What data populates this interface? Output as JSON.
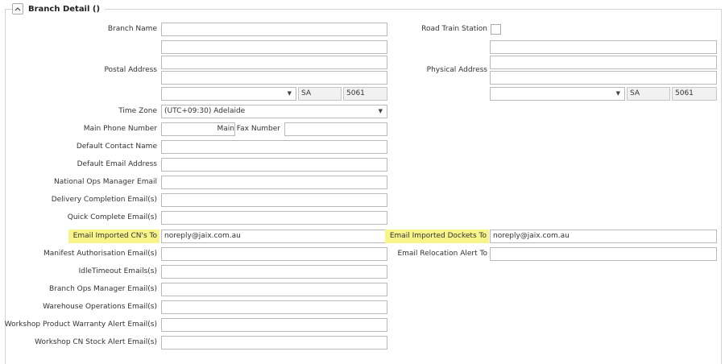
{
  "group": {
    "title": "Branch Detail ()"
  },
  "labels": {
    "branch_name": "Branch Name",
    "postal_address": "Postal Address",
    "time_zone": "Time Zone",
    "main_phone": "Main Phone Number",
    "main_fax": "Main Fax Number",
    "default_contact": "Default Contact Name",
    "default_email": "Default Email Address",
    "national_ops": "National Ops Manager Email",
    "delivery_completion": "Delivery Completion Email(s)",
    "quick_complete": "Quick Complete Email(s)",
    "email_imported_cns": "Email Imported CN's To",
    "manifest_auth": "Manifest Authorisation Email(s)",
    "idle_timeout": "IdleTimeout Emails(s)",
    "branch_ops": "Branch Ops Manager Email(s)",
    "warehouse_ops": "Warehouse Operations Email(s)",
    "workshop_warranty": "Workshop Product Warranty Alert Email(s)",
    "workshop_cn_stock": "Workshop CN Stock Alert Email(s)",
    "road_train": "Road Train Station",
    "physical_address": "Physical Address",
    "email_imported_dockets": "Email Imported Dockets To",
    "email_relocation": "Email Relocation Alert To"
  },
  "values": {
    "postal_state": "SA",
    "postal_postcode": "5061",
    "physical_state": "SA",
    "physical_postcode": "5061",
    "time_zone": "(UTC+09:30) Adelaide",
    "email_imported_cns": "noreply@jaix.com.au",
    "email_imported_dockets": "noreply@jaix.com.au"
  },
  "colors": {
    "highlight": "#f7f58a",
    "border": "#b9b9b9"
  }
}
